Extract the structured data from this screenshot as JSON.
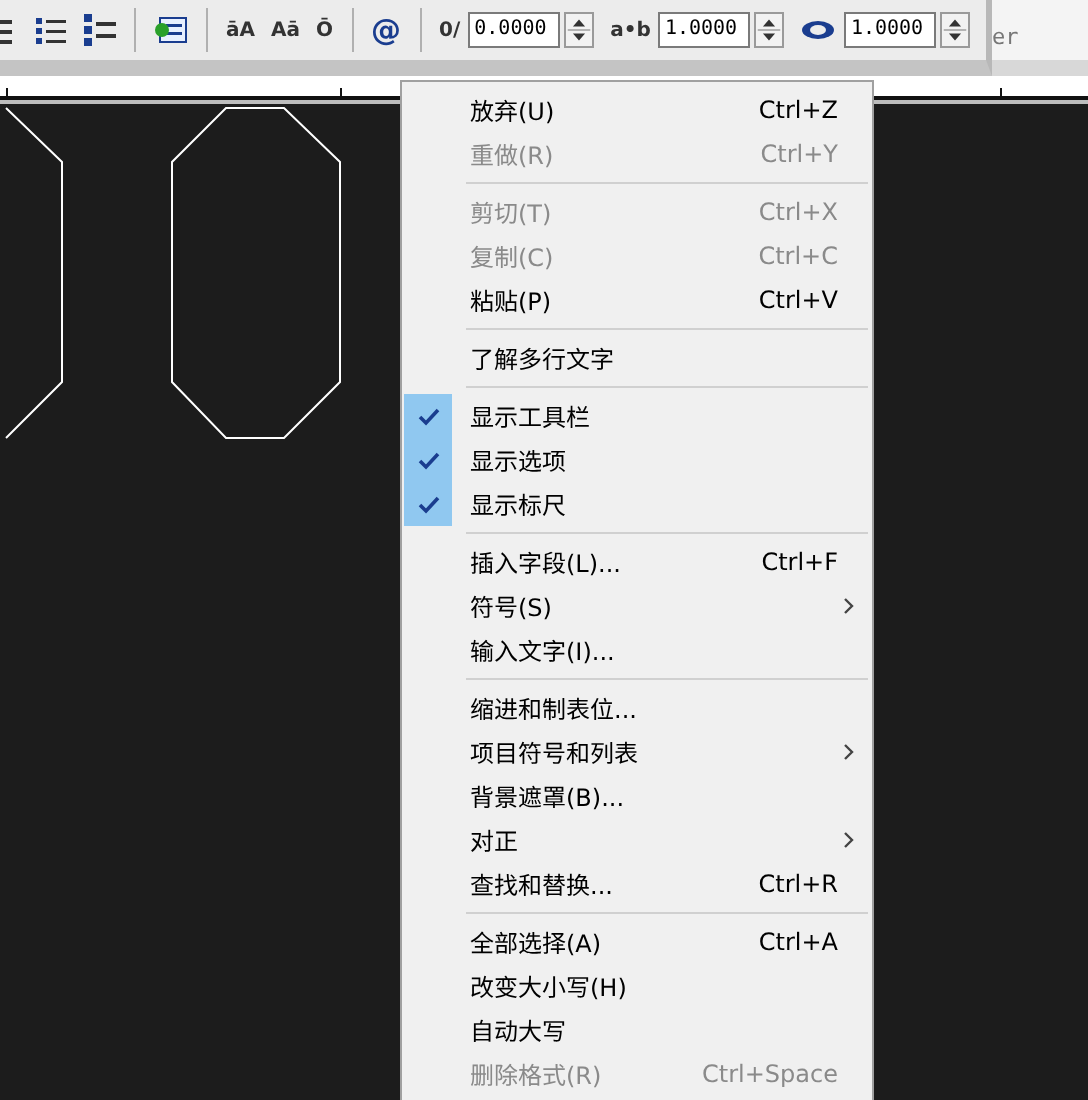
{
  "toolbar": {
    "glyph_buttons": [
      {
        "glyph": "āA"
      },
      {
        "glyph": "Aā"
      },
      {
        "glyph": "Ō"
      },
      {
        "glyph": "@"
      }
    ],
    "fields": [
      {
        "glyph": "0/",
        "value": "0.0000"
      },
      {
        "glyph": "a•b",
        "value": "1.0000"
      },
      {
        "value": "1.0000"
      }
    ]
  },
  "side_panel": {
    "text": "er"
  },
  "context_menu": {
    "items": [
      {
        "kind": "item",
        "label": "放弃(U)",
        "shortcut": "Ctrl+Z",
        "disabled": false,
        "checked": false,
        "submenu": false
      },
      {
        "kind": "item",
        "label": "重做(R)",
        "shortcut": "Ctrl+Y",
        "disabled": true,
        "checked": false,
        "submenu": false
      },
      {
        "kind": "separator"
      },
      {
        "kind": "item",
        "label": "剪切(T)",
        "shortcut": "Ctrl+X",
        "disabled": true,
        "checked": false,
        "submenu": false
      },
      {
        "kind": "item",
        "label": "复制(C)",
        "shortcut": "Ctrl+C",
        "disabled": true,
        "checked": false,
        "submenu": false
      },
      {
        "kind": "item",
        "label": "粘贴(P)",
        "shortcut": "Ctrl+V",
        "disabled": false,
        "checked": false,
        "submenu": false
      },
      {
        "kind": "separator"
      },
      {
        "kind": "item",
        "label": "了解多行文字",
        "disabled": false,
        "checked": false,
        "submenu": false
      },
      {
        "kind": "separator"
      },
      {
        "kind": "item",
        "label": "显示工具栏",
        "disabled": false,
        "checked": true,
        "submenu": false
      },
      {
        "kind": "item",
        "label": "显示选项",
        "disabled": false,
        "checked": true,
        "submenu": false
      },
      {
        "kind": "item",
        "label": "显示标尺",
        "disabled": false,
        "checked": true,
        "submenu": false
      },
      {
        "kind": "separator"
      },
      {
        "kind": "item",
        "label": "插入字段(L)...",
        "shortcut": "Ctrl+F",
        "disabled": false,
        "checked": false,
        "submenu": false
      },
      {
        "kind": "item",
        "label": "符号(S)",
        "disabled": false,
        "checked": false,
        "submenu": true
      },
      {
        "kind": "item",
        "label": "输入文字(I)...",
        "disabled": false,
        "checked": false,
        "submenu": false
      },
      {
        "kind": "separator"
      },
      {
        "kind": "item",
        "label": "缩进和制表位...",
        "disabled": false,
        "checked": false,
        "submenu": false
      },
      {
        "kind": "item",
        "label": "项目符号和列表",
        "disabled": false,
        "checked": false,
        "submenu": true
      },
      {
        "kind": "item",
        "label": "背景遮罩(B)...",
        "disabled": false,
        "checked": false,
        "submenu": false
      },
      {
        "kind": "item",
        "label": "对正",
        "disabled": false,
        "checked": false,
        "submenu": true
      },
      {
        "kind": "item",
        "label": "查找和替换...",
        "shortcut": "Ctrl+R",
        "disabled": false,
        "checked": false,
        "submenu": false
      },
      {
        "kind": "separator"
      },
      {
        "kind": "item",
        "label": "全部选择(A)",
        "shortcut": "Ctrl+A",
        "disabled": false,
        "checked": false,
        "submenu": false
      },
      {
        "kind": "item",
        "label": "改变大小写(H)",
        "disabled": false,
        "checked": false,
        "submenu": false
      },
      {
        "kind": "item",
        "label": "自动大写",
        "disabled": false,
        "checked": false,
        "submenu": false
      },
      {
        "kind": "item",
        "label": "删除格式(R)",
        "shortcut": "Ctrl+Space",
        "disabled": true,
        "checked": false,
        "submenu": false
      }
    ]
  }
}
